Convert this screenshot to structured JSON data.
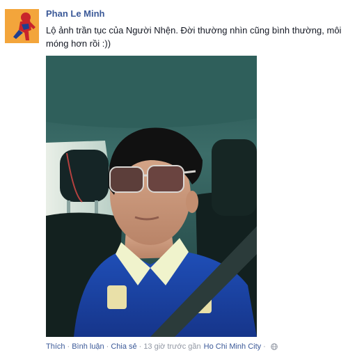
{
  "post": {
    "author_name": "Phan Le Minh",
    "status_text": "Lộ ảnh trần tục của Người Nhện. Đời thường nhìn cũng bình thường, môi móng hơn rồi :))",
    "avatar_icon": "spiderman-avatar-icon",
    "photo": "selfie-in-car-photo",
    "footer": {
      "like_label": "Thích",
      "comment_label": "Bình luận",
      "share_label": "Chia sẻ",
      "separator": "·",
      "time_text": "13 giờ trước gần",
      "location_text": "Ho Chi Minh City",
      "privacy_icon": "globe-icon"
    }
  },
  "colors": {
    "link_blue": "#3b5998",
    "meta_gray": "#9197a3",
    "text": "#141823"
  }
}
